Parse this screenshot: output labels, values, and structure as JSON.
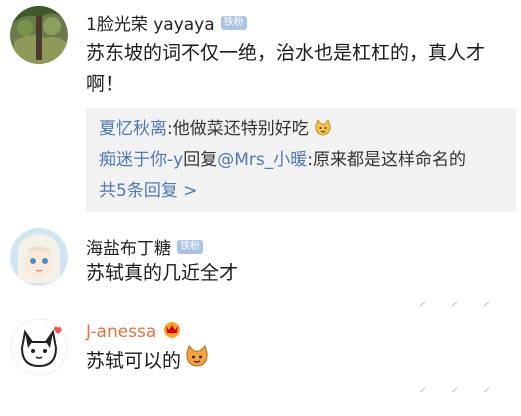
{
  "comments": [
    {
      "username": "1脸光荣 yayaya",
      "badge": "铁粉",
      "text": "苏东坡的词不仅一绝，治水也是杠杠的，真人才啊！",
      "replies": [
        {
          "name": "夏忆秋离",
          "colon": ":",
          "content": "他做菜还特别好吃"
        },
        {
          "name": "痴迷于你-y",
          "mid": "回复",
          "mention": "@Mrs_小暖",
          "colon": ":",
          "content": "原来都是这样命名的"
        }
      ],
      "more_replies": "共5条回复 >"
    },
    {
      "username": "海盐布丁糖",
      "badge": "铁粉",
      "text": "苏轼真的几近全才"
    },
    {
      "username": "J-anessa",
      "text": "苏轼可以的"
    }
  ]
}
